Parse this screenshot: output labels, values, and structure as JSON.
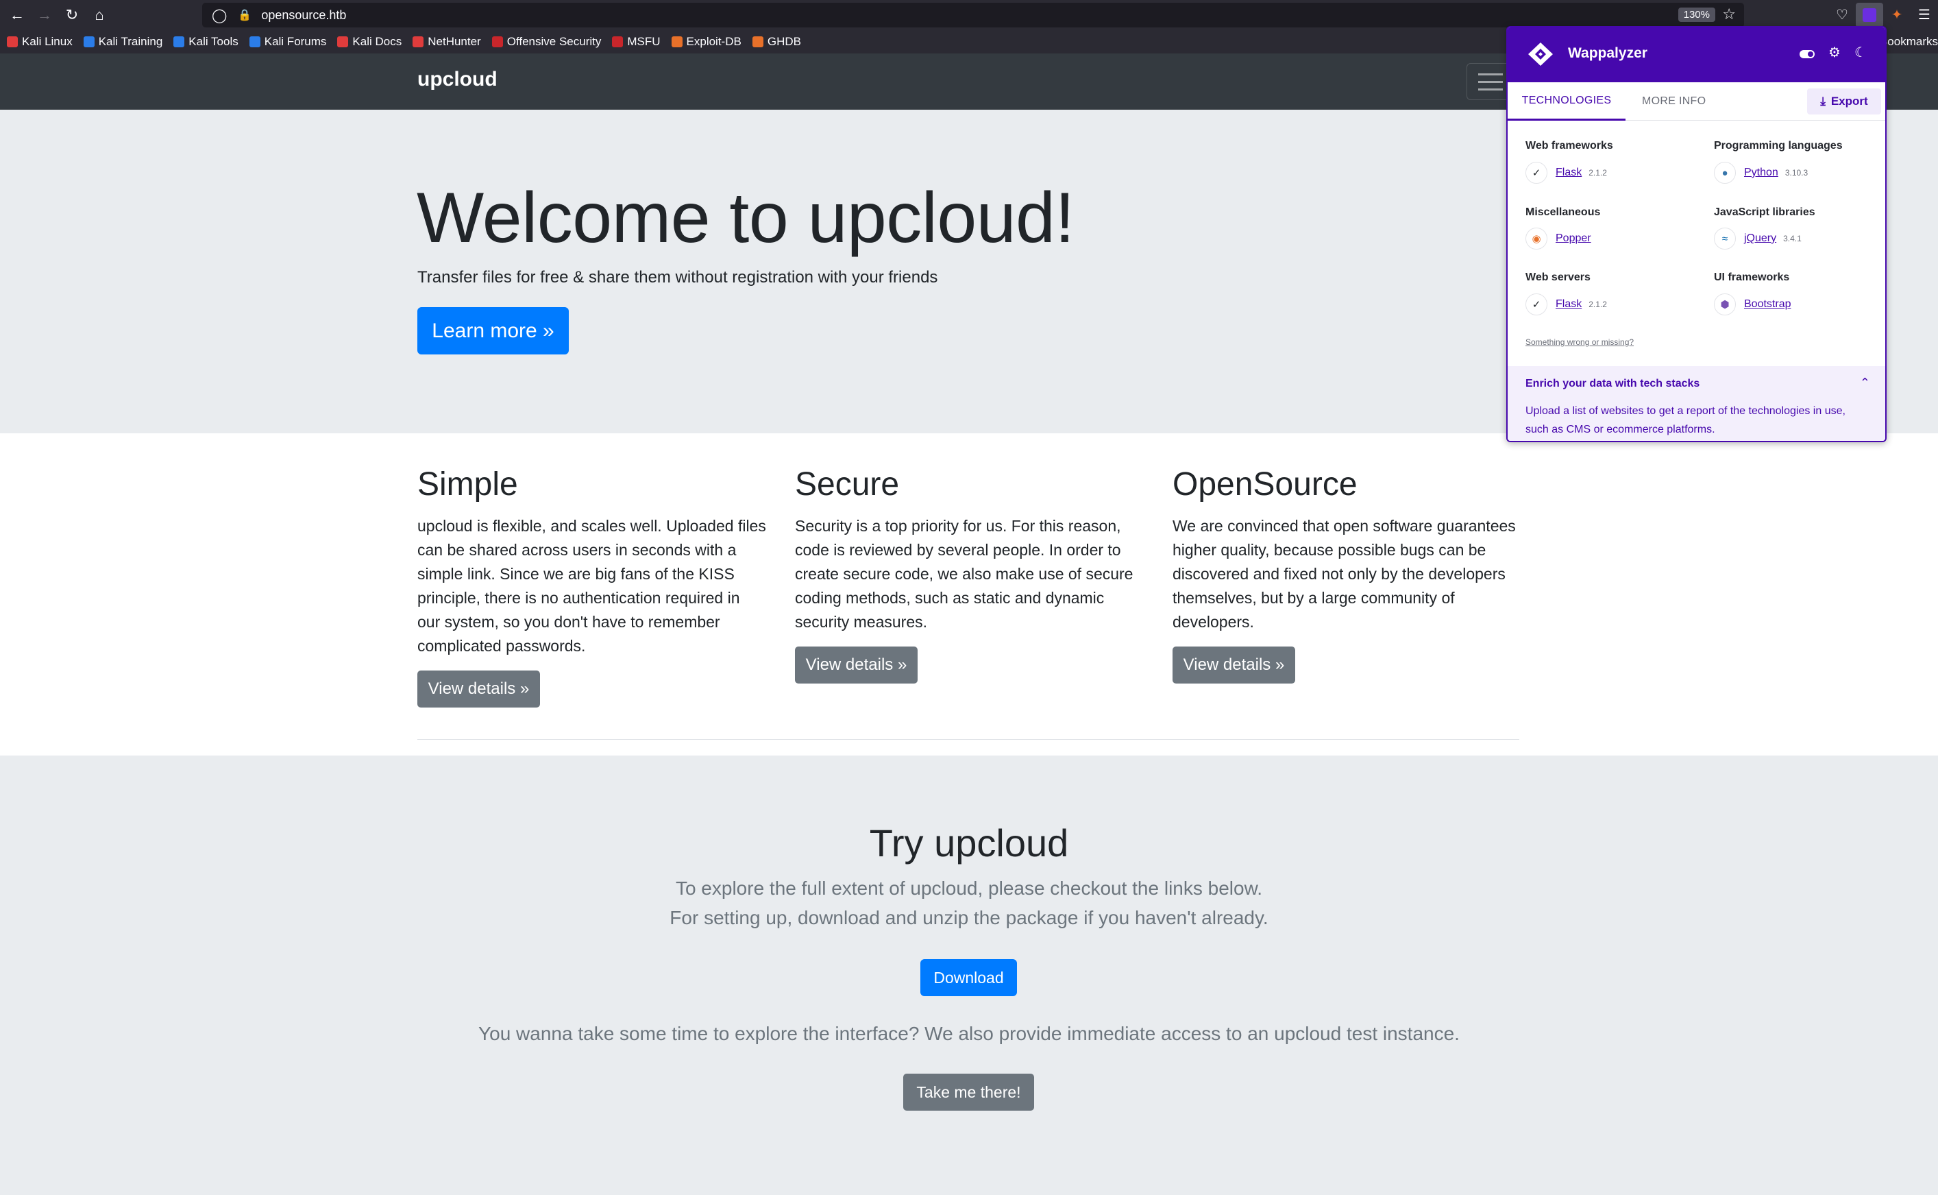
{
  "browser": {
    "url": "opensource.htb",
    "zoom": "130%",
    "bookmarks": [
      {
        "label": "Kali Linux",
        "color": "#e03c3c"
      },
      {
        "label": "Kali Training",
        "color": "#2b7de9"
      },
      {
        "label": "Kali Tools",
        "color": "#2b7de9"
      },
      {
        "label": "Kali Forums",
        "color": "#2b7de9"
      },
      {
        "label": "Kali Docs",
        "color": "#e03c3c"
      },
      {
        "label": "NetHunter",
        "color": "#e03c3c"
      },
      {
        "label": "Offensive Security",
        "color": "#c8262b"
      },
      {
        "label": "MSFU",
        "color": "#c8262b"
      },
      {
        "label": "Exploit-DB",
        "color": "#e8712a"
      },
      {
        "label": "GHDB",
        "color": "#e8712a"
      }
    ],
    "bookmarks_overflow": "Bookmarks"
  },
  "site": {
    "brand": "upcloud",
    "hero": {
      "title": "Welcome to upcloud!",
      "subtitle": "Transfer files for free & share them without registration with your friends",
      "button": "Learn more »"
    },
    "features": [
      {
        "title": "Simple",
        "text": "upcloud is flexible, and scales well. Uploaded files can be shared across users in seconds with a simple link. Since we are big fans of the KISS principle, there is no authentication required in our system, so you don't have to remember complicated passwords.",
        "button": "View details »"
      },
      {
        "title": "Secure",
        "text": "Security is a top priority for us. For this reason, code is reviewed by several people. In order to create secure code, we also make use of secure coding methods, such as static and dynamic security measures.",
        "button": "View details »"
      },
      {
        "title": "OpenSource",
        "text": "We are convinced that open software guarantees higher quality, because possible bugs can be discovered and fixed not only by the developers themselves, but by a large community of developers.",
        "button": "View details »"
      }
    ],
    "try": {
      "title": "Try upcloud",
      "line1": "To explore the full extent of upcloud, please checkout the links below.",
      "line2": "For setting up, download and unzip the package if you haven't already.",
      "download": "Download",
      "line3": "You wanna take some time to explore the interface? We also provide immediate access to an upcloud test instance.",
      "take": "Take me there!"
    }
  },
  "wappalyzer": {
    "title": "Wappalyzer",
    "tabs": [
      "TECHNOLOGIES",
      "MORE INFO"
    ],
    "export": "Export",
    "categories": [
      {
        "name": "Web frameworks",
        "tech": "Flask",
        "version": "2.1.2",
        "icon": "flask-icon"
      },
      {
        "name": "Programming languages",
        "tech": "Python",
        "version": "3.10.3",
        "icon": "python-icon"
      },
      {
        "name": "Miscellaneous",
        "tech": "Popper",
        "version": "",
        "icon": "popper-icon"
      },
      {
        "name": "JavaScript libraries",
        "tech": "jQuery",
        "version": "3.4.1",
        "icon": "jquery-icon"
      },
      {
        "name": "Web servers",
        "tech": "Flask",
        "version": "2.1.2",
        "icon": "flask-icon"
      },
      {
        "name": "UI frameworks",
        "tech": "Bootstrap",
        "version": "",
        "icon": "bootstrap-icon"
      }
    ],
    "wrong_link": "Something wrong or missing?",
    "enrich_title": "Enrich your data with tech stacks",
    "enrich_text": "Upload a list of websites to get a report of the technologies in use, such as CMS or ecommerce platforms.",
    "accent": "#4608ad"
  }
}
